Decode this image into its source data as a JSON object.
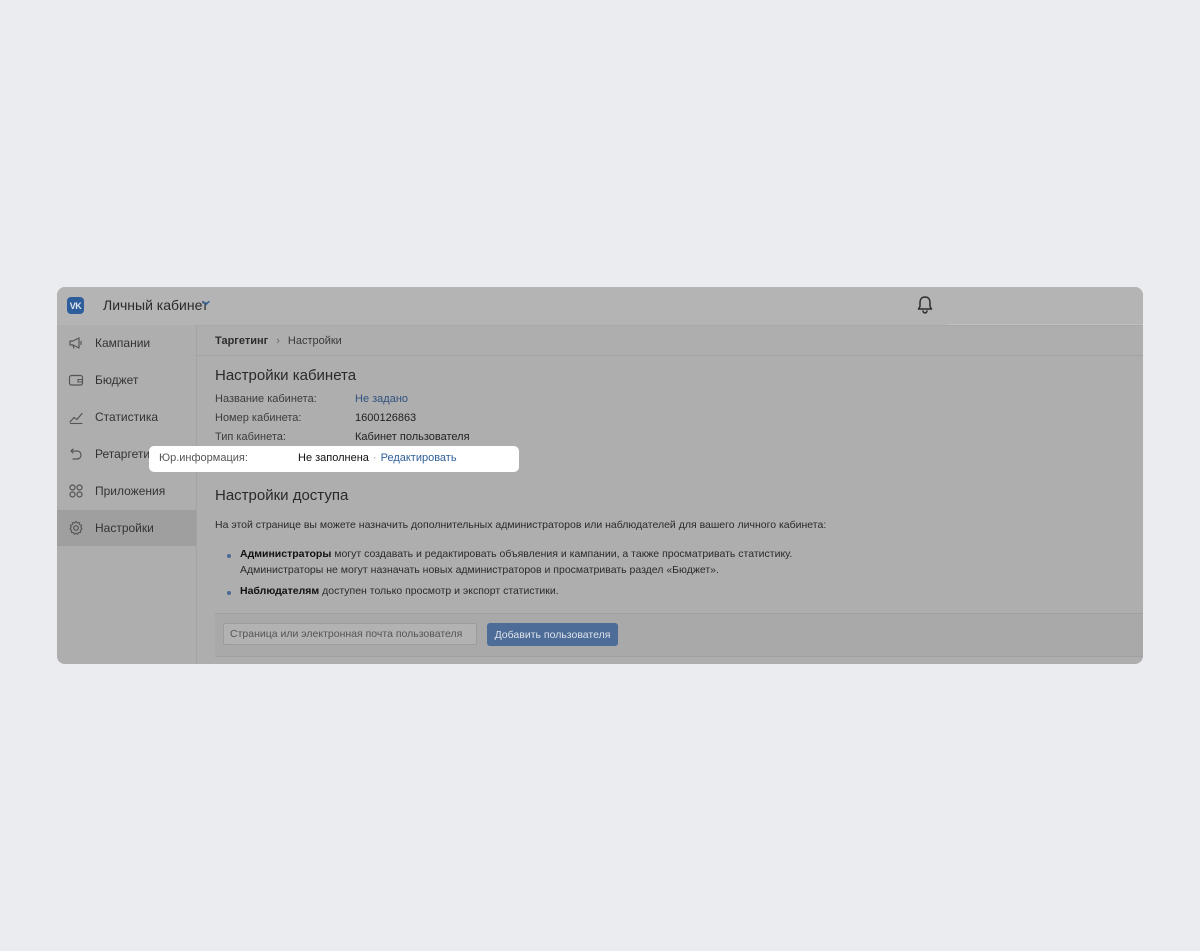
{
  "header": {
    "logo_text": "VK",
    "app_title": "Личный кабинет"
  },
  "sidebar": {
    "items": [
      {
        "label": "Кампании",
        "icon": "megaphone-icon"
      },
      {
        "label": "Бюджет",
        "icon": "wallet-icon"
      },
      {
        "label": "Статистика",
        "icon": "chart-line-icon"
      },
      {
        "label": "Ретаргетинг",
        "icon": "retarget-arrow-icon"
      },
      {
        "label": "Приложения",
        "icon": "apps-grid-icon"
      },
      {
        "label": "Настройки",
        "icon": "gear-icon",
        "active": true
      }
    ]
  },
  "breadcrumb": {
    "root": "Таргетинг",
    "current": "Настройки"
  },
  "cabinet_settings": {
    "title": "Настройки кабинета",
    "name_label": "Название кабинета:",
    "name_value": "Не задано",
    "number_label": "Номер кабинета:",
    "number_value": "1600126863",
    "type_label": "Тип кабинета:",
    "type_value": "Кабинет пользователя",
    "legal_label": "Юр.информация:",
    "legal_value": "Не заполнена",
    "legal_separator": "·",
    "legal_edit": "Редактировать"
  },
  "access_settings": {
    "title": "Настройки доступа",
    "intro": "На этой странице вы можете назначить дополнительных администраторов или наблюдателей для вашего личного кабинета:",
    "admins_bold": "Администраторы",
    "admins_text": " могут создавать и редактировать объявления и кампании, а также просматривать статистику.",
    "admins_text2": "Администраторы не могут назначать новых администраторов и просматривать раздел «Бюджет».",
    "observers_bold": "Наблюдателям",
    "observers_text": " доступен только просмотр и экспорт статистики.",
    "input_placeholder": "Страница или электронная почта пользователя",
    "add_button": "Добавить пользователя"
  },
  "colors": {
    "background": "#ebecef",
    "overlay_dim": "#aeaeae",
    "link": "#2f5f9a",
    "button": "#4e6c98",
    "highlight": "#ffffff"
  }
}
